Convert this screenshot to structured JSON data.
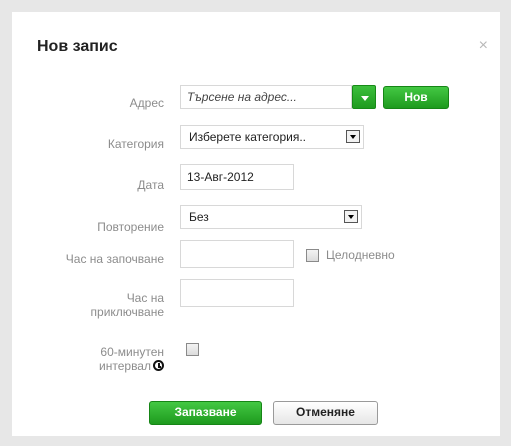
{
  "dialog": {
    "title": "Нов запис",
    "close_symbol": "×"
  },
  "form": {
    "address": {
      "label": "Адрес",
      "placeholder": "Търсене на адрес...",
      "new_button": "Нов"
    },
    "category": {
      "label": "Категория",
      "selected": "Изберете категория.."
    },
    "date": {
      "label": "Дата",
      "value": "13-Авг-2012"
    },
    "repeat": {
      "label": "Повторение",
      "selected": "Без"
    },
    "start_time": {
      "label": "Час на започване",
      "value": "",
      "all_day_label": "Целодневно",
      "all_day_checked": false
    },
    "end_time": {
      "label_line1": "Час на",
      "label_line2": "приключване",
      "value": ""
    },
    "interval": {
      "label_line1": "60-минутен",
      "label_line2": "интервал",
      "checked": false,
      "icon": "clock-icon"
    }
  },
  "actions": {
    "save": "Запазване",
    "cancel": "Отменяне"
  },
  "colors": {
    "accent_green": "#2aa52a",
    "background": "#e7e7e7"
  }
}
